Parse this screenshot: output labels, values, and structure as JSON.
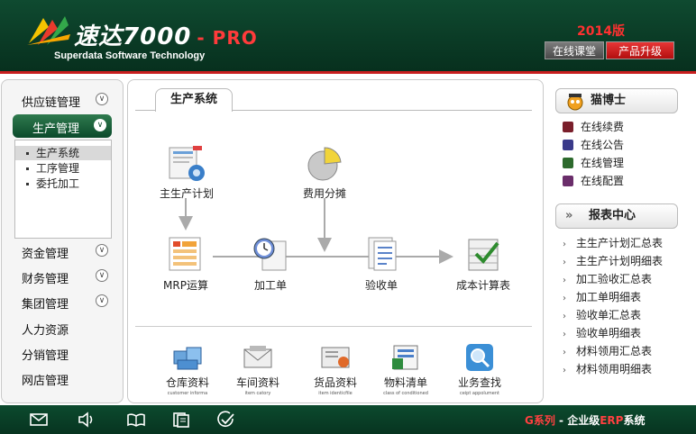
{
  "header": {
    "brand_cn": "速达",
    "brand_num": "7000",
    "brand_pro": "- PRO",
    "brand_sub": "Superdata Software Technology",
    "year": "2014版",
    "online_course": "在线课堂",
    "upgrade": "产品升级"
  },
  "sidebar": {
    "items": [
      {
        "label": "供应链管理"
      },
      {
        "label": "生产管理"
      },
      {
        "label": "资金管理"
      },
      {
        "label": "财务管理"
      },
      {
        "label": "集团管理"
      },
      {
        "label": "人力资源"
      },
      {
        "label": "分销管理"
      },
      {
        "label": "网店管理"
      }
    ],
    "submenu": [
      {
        "label": "生产系统"
      },
      {
        "label": "工序管理"
      },
      {
        "label": "委托加工"
      }
    ]
  },
  "main": {
    "tab": "生产系统",
    "flow": {
      "master_plan": "主生产计划",
      "cost_share": "费用分摊",
      "mrp": "MRP运算",
      "work_order": "加工单",
      "acceptance": "验收单",
      "cost_table": "成本计算表"
    },
    "bottom": [
      {
        "label": "仓库资料",
        "sub": "customer informa"
      },
      {
        "label": "车间资料",
        "sub": "item catory"
      },
      {
        "label": "货品资料",
        "sub": "item identicfile"
      },
      {
        "label": "物料清单",
        "sub": "class of conditioned"
      },
      {
        "label": "业务查找",
        "sub": "ceipt appolument"
      }
    ]
  },
  "right": {
    "dr_title": "猫博士",
    "dr_links": [
      {
        "label": "在线续费",
        "color": "#7a1f2b"
      },
      {
        "label": "在线公告",
        "color": "#3a3a8a"
      },
      {
        "label": "在线管理",
        "color": "#2d6a2d"
      },
      {
        "label": "在线配置",
        "color": "#6a2d6a"
      }
    ],
    "report_title": "报表中心",
    "report_arrow": "»",
    "reports": [
      {
        "label": "主生产计划汇总表"
      },
      {
        "label": "主生产计划明细表"
      },
      {
        "label": "加工验收汇总表"
      },
      {
        "label": "加工单明细表"
      },
      {
        "label": "验收单汇总表"
      },
      {
        "label": "验收单明细表"
      },
      {
        "label": "材料领用汇总表"
      },
      {
        "label": "材料领用明细表"
      }
    ]
  },
  "footer": {
    "series": "G系列",
    "dash": " - ",
    "level": "企业级",
    "erp": "ERP",
    "system": "系统"
  }
}
